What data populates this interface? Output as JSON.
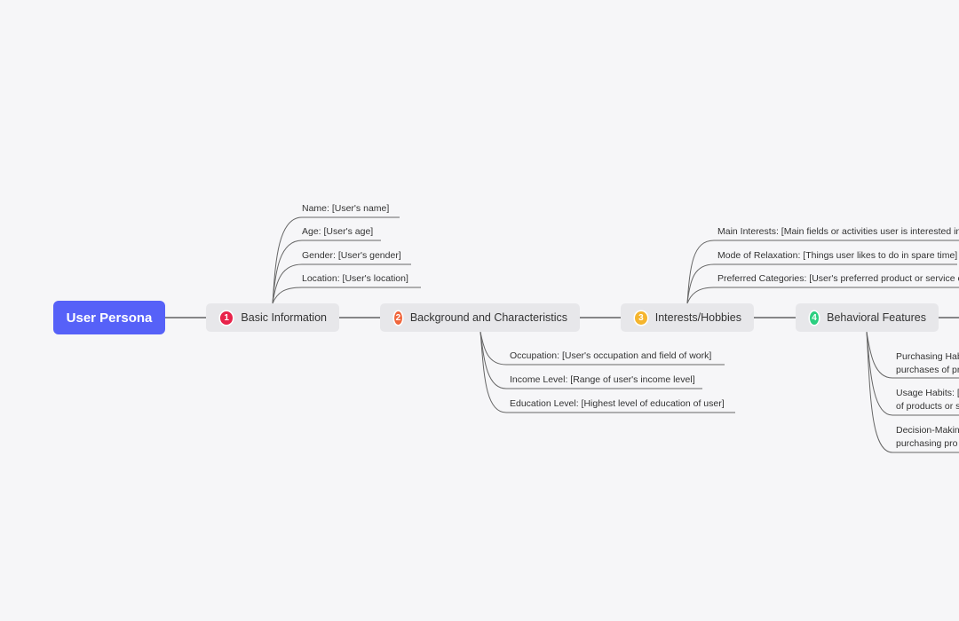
{
  "root": {
    "label": "User Persona",
    "color": "#5661f8"
  },
  "topics": [
    {
      "num": "1",
      "label": "Basic Information",
      "badge_color": "#e8234a",
      "children": [
        "Name: [User's name]",
        "Age: [User's age]",
        "Gender: [User's gender]",
        "Location: [User's location]"
      ]
    },
    {
      "num": "2",
      "label": "Background and Characteristics",
      "badge_color": "#f0663c",
      "children": [
        "Occupation: [User's occupation and field of work]",
        "Income Level: [Range of user's income level]",
        "Education Level: [Highest level of education of user]"
      ]
    },
    {
      "num": "3",
      "label": "Interests/Hobbies",
      "badge_color": "#f5b52e",
      "children": [
        "Main Interests: [Main fields or activities user is interested in",
        "Mode of Relaxation: [Things user likes to do in spare time]",
        "Preferred Categories: [User's preferred product or service c"
      ]
    },
    {
      "num": "4",
      "label": "Behavioral Features",
      "badge_color": "#2ccf80",
      "children": [
        {
          "line1": "Purchasing Hab",
          "line2": "purchases of pr"
        },
        {
          "line1": "Usage Habits: [",
          "line2": "of products or s"
        },
        {
          "line1": "Decision-Makin",
          "line2": "purchasing pro"
        }
      ]
    }
  ]
}
